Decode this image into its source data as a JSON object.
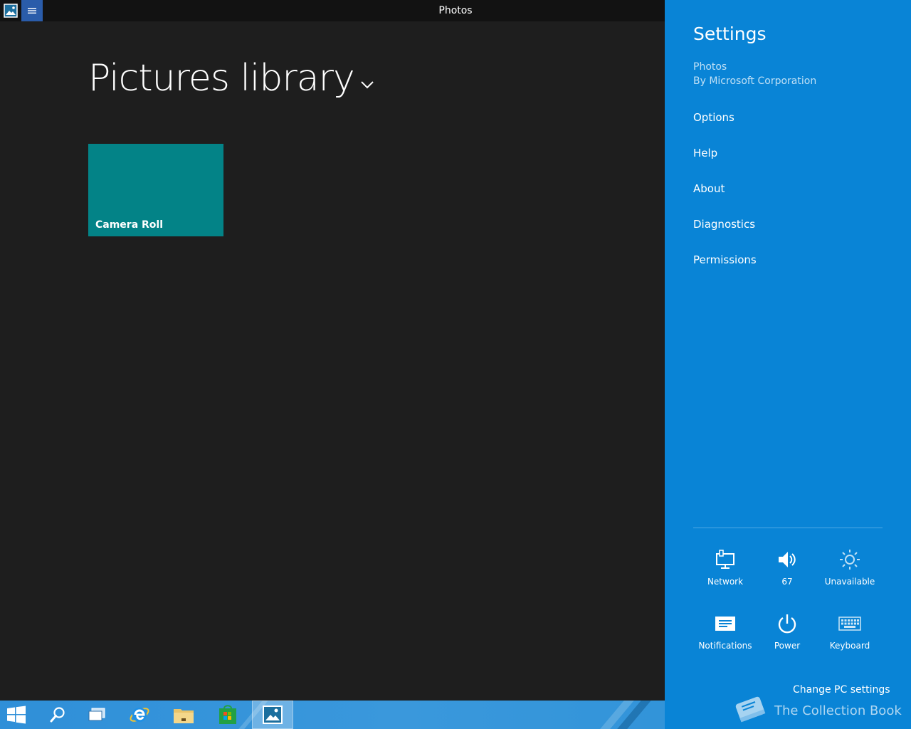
{
  "window": {
    "title": "Photos",
    "icons": {
      "app": "photos-app-icon",
      "menu": "hamburger-menu-icon"
    }
  },
  "main": {
    "heading": "Pictures library",
    "heading_icon": "chevron-down-icon",
    "tiles": [
      {
        "label": "Camera Roll",
        "color": "#038387"
      }
    ]
  },
  "settings": {
    "title": "Settings",
    "app_name": "Photos",
    "publisher": "By Microsoft Corporation",
    "menu": [
      {
        "label": "Options"
      },
      {
        "label": "Help"
      },
      {
        "label": "About"
      },
      {
        "label": "Diagnostics"
      },
      {
        "label": "Permissions"
      }
    ],
    "quick_actions": [
      {
        "label": "Network",
        "icon": "network-icon"
      },
      {
        "label": "67",
        "icon": "volume-icon"
      },
      {
        "label": "Unavailable",
        "icon": "brightness-icon"
      },
      {
        "label": "Notifications",
        "icon": "notifications-icon"
      },
      {
        "label": "Power",
        "icon": "power-icon"
      },
      {
        "label": "Keyboard",
        "icon": "keyboard-icon"
      }
    ],
    "change_pc_settings": "Change PC settings",
    "watermark": "The Collection Book",
    "accent": "#0984d6"
  },
  "taskbar": {
    "items": [
      {
        "icon": "windows-start-icon"
      },
      {
        "icon": "search-icon"
      },
      {
        "icon": "task-view-icon"
      },
      {
        "icon": "internet-explorer-icon"
      },
      {
        "icon": "file-explorer-icon"
      },
      {
        "icon": "store-icon"
      },
      {
        "icon": "photos-app-icon",
        "active": true
      }
    ]
  }
}
